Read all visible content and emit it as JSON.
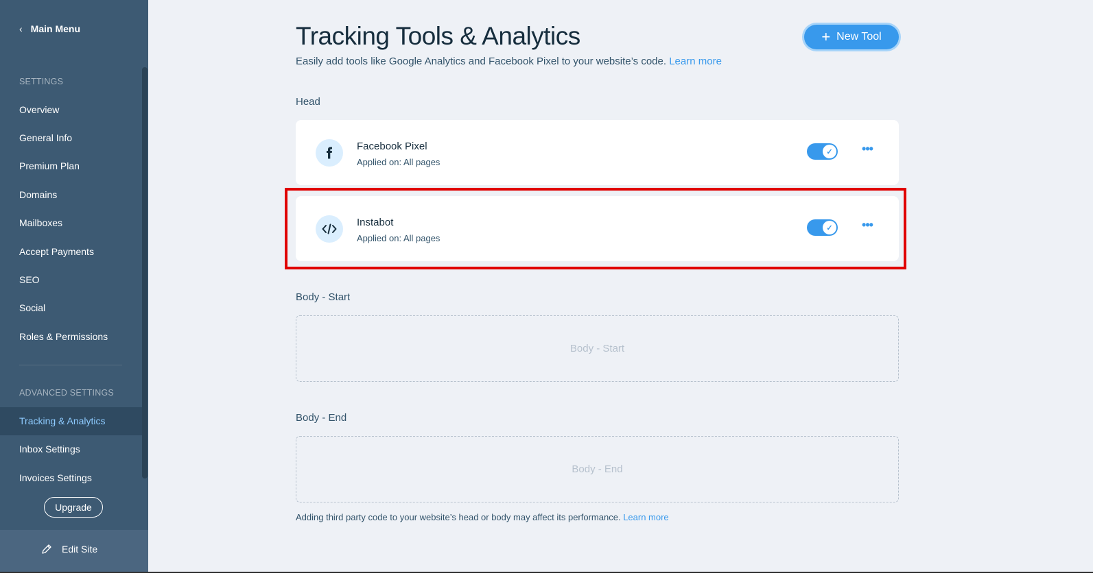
{
  "sidebar": {
    "main_menu": "Main Menu",
    "settings_label": "SETTINGS",
    "items": [
      {
        "label": "Overview"
      },
      {
        "label": "General Info"
      },
      {
        "label": "Premium Plan"
      },
      {
        "label": "Domains"
      },
      {
        "label": "Mailboxes"
      },
      {
        "label": "Accept Payments"
      },
      {
        "label": "SEO"
      },
      {
        "label": "Social"
      },
      {
        "label": "Roles & Permissions"
      }
    ],
    "advanced_label": "ADVANCED SETTINGS",
    "advanced_items": [
      {
        "label": "Tracking & Analytics",
        "active": true
      },
      {
        "label": "Inbox Settings"
      },
      {
        "label": "Invoices Settings"
      }
    ],
    "upgrade": "Upgrade",
    "edit_site": "Edit Site"
  },
  "main": {
    "title": "Tracking Tools & Analytics",
    "subtitle": "Easily add tools like Google Analytics and Facebook Pixel to your website’s code.",
    "subtitle_link": "Learn more",
    "new_tool": "New Tool",
    "head_label": "Head",
    "tools": [
      {
        "name": "Facebook Pixel",
        "applied": "Applied on: All pages",
        "icon": "facebook-icon",
        "enabled": true
      },
      {
        "name": "Instabot",
        "applied": "Applied on: All pages",
        "icon": "code-icon",
        "enabled": true
      }
    ],
    "body_start_label": "Body - Start",
    "body_start_placeholder": "Body - Start",
    "body_end_label": "Body - End",
    "body_end_placeholder": "Body - End",
    "footnote": "Adding third party code to your website’s head or body may affect its performance.",
    "footnote_link": "Learn more"
  },
  "colors": {
    "accent": "#3899ec",
    "sidebar": "#3d5a73",
    "highlight": "#e00000"
  }
}
